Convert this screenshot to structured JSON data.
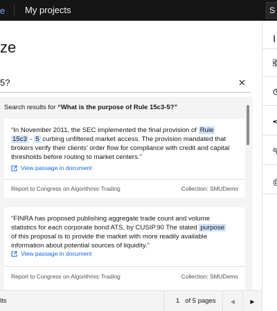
{
  "header": {
    "active_tab_label": "e",
    "projects_label": "My projects",
    "right_label": "S"
  },
  "page": {
    "title": "ze"
  },
  "right_panel": {
    "title": "I",
    "icons": [
      "grid-icon",
      "history-icon",
      "share-icon",
      "settings-icon",
      "at-icon"
    ]
  },
  "search": {
    "value": "5?",
    "clear_icon": "close-icon"
  },
  "results": {
    "header_prefix": "Search results for ",
    "header_query": "“What is the purpose of Rule 15c3-5?”",
    "cards": [
      {
        "text_before": "“In November 2011, the SEC implemented the final provision of ",
        "hl1": "Rule",
        "hl2": "15c3",
        "dash": " - ",
        "hl3": "5",
        "text_after": " curbing unfiltered market access. The provision mandated that brokers verify their clients’ order flow for compliance with credit and capital thresholds before routing to market centers.”",
        "link_label": "View passage in document",
        "source": "Report to Congress on Algorithmic Trading",
        "collection": "Collection: SMUDemo"
      },
      {
        "text_before": "“FINRA has proposed publishing aggregate trade count and volume statistics for each corporate bond ATS, by CUSIP.90 The stated ",
        "hl1": "purpose",
        "text_after": " of this proposal is to provide the market with more readily available information about potential sources of liquidity.”",
        "link_label": "View passage in document",
        "source": "Report to Congress on Algorithmic Trading",
        "collection": "Collection: SMUDemo"
      }
    ]
  },
  "pagination": {
    "left_label": "lts",
    "page_number": "1",
    "page_suffix": "of 5 pages"
  }
}
